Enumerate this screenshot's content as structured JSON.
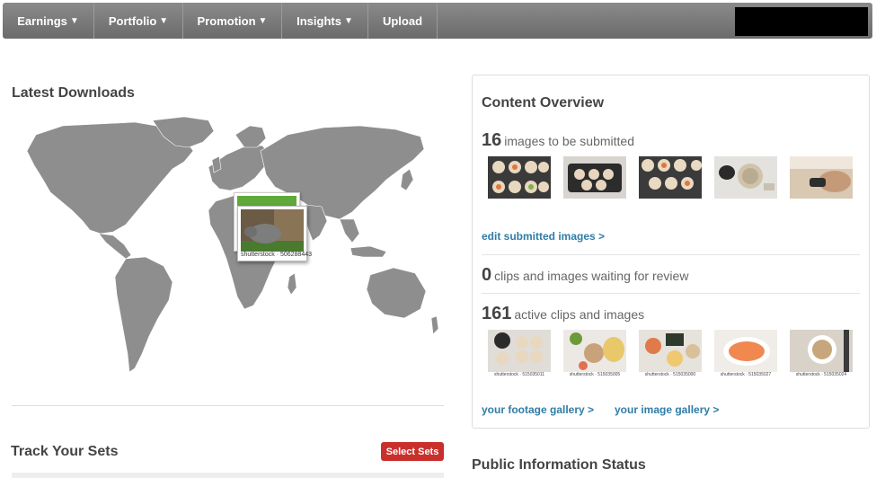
{
  "nav": {
    "items": [
      {
        "label": "Earnings",
        "dropdown": true
      },
      {
        "label": "Portfolio",
        "dropdown": true
      },
      {
        "label": "Promotion",
        "dropdown": true
      },
      {
        "label": "Insights",
        "dropdown": true
      },
      {
        "label": "Upload",
        "dropdown": false
      }
    ]
  },
  "left": {
    "latest_downloads_title": "Latest Downloads",
    "popup_caption": "shutterstock · 506288443",
    "track_sets_title": "Track Your Sets",
    "select_sets_label": "Select Sets"
  },
  "overview": {
    "title": "Content Overview",
    "to_submit_count": "16",
    "to_submit_text": "images to be submitted",
    "edit_link": "edit submitted images >",
    "waiting_count": "0",
    "waiting_text": "clips and images waiting for review",
    "active_count": "161",
    "active_text": "active clips and images",
    "footage_link": "your footage gallery >",
    "image_link": "your image gallery >",
    "active_captions": [
      "shutterstock · 515035011",
      "shutterstock · 515035005",
      "shutterstock · 515035000",
      "shutterstock · 515035027",
      "shutterstock · 515035024"
    ]
  },
  "public_info_title": "Public Information Status",
  "colors": {
    "nav": "#777777",
    "accent_link": "#2f7ca6",
    "button_red": "#c9302c",
    "map_land": "#8e8e8e"
  }
}
